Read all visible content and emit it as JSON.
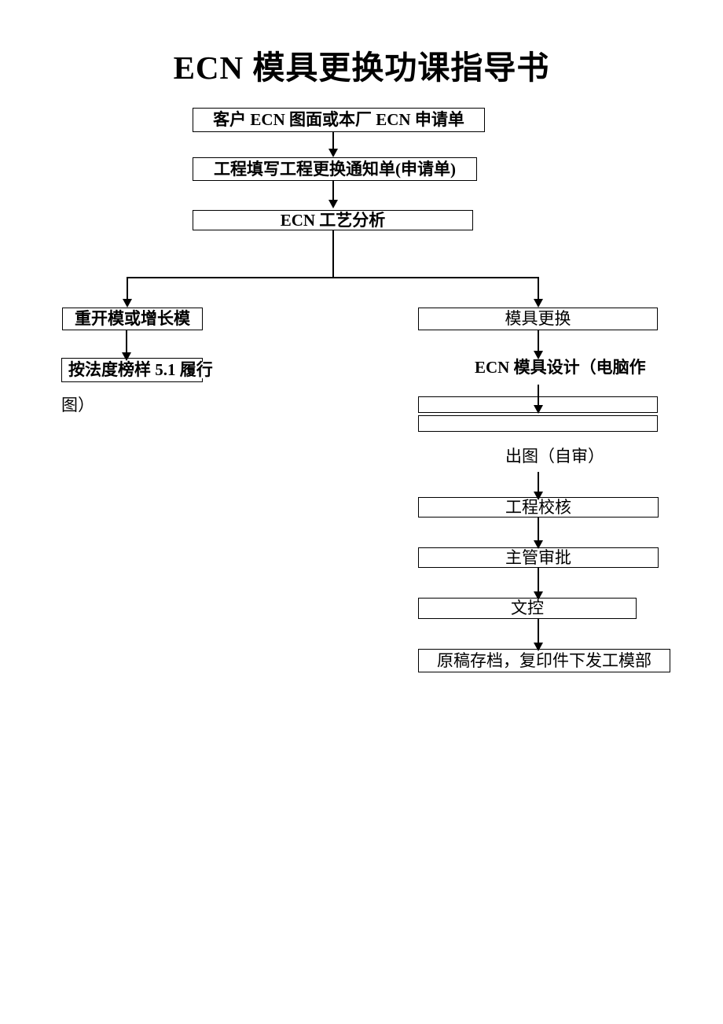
{
  "document": {
    "title": "ECN 模具更换功课指导书"
  },
  "flow": {
    "nodes": [
      {
        "id": "customer-ecn",
        "label": "客户 ECN 图面或本厂 ECN 申请单"
      },
      {
        "id": "engineering-form",
        "label": "工程填写工程更换通知单(申请单)"
      },
      {
        "id": "process-analysis",
        "label": "ECN 工艺分析"
      },
      {
        "id": "remake-mold",
        "label": "重开模或增长模"
      },
      {
        "id": "mold-change",
        "label": "模具更换"
      },
      {
        "id": "procedure-5-1",
        "label": "按法度榜样 5.1 履行"
      },
      {
        "id": "procedure-wrap",
        "label": "图）"
      },
      {
        "id": "mold-design",
        "label": "ECN 模具设计（电脑作"
      },
      {
        "id": "blank-box-1",
        "label": ""
      },
      {
        "id": "blank-box-2",
        "label": ""
      },
      {
        "id": "drawing-selfcheck",
        "label": "出图（自审）"
      },
      {
        "id": "engineering-check",
        "label": "工程校核"
      },
      {
        "id": "manager-approve",
        "label": "主管审批"
      },
      {
        "id": "document-control",
        "label": "文控"
      },
      {
        "id": "archive-dispatch",
        "label": "原稿存档，复印件下发工模部"
      }
    ]
  },
  "colors": {
    "ink": "#000000",
    "paper": "#ffffff"
  }
}
